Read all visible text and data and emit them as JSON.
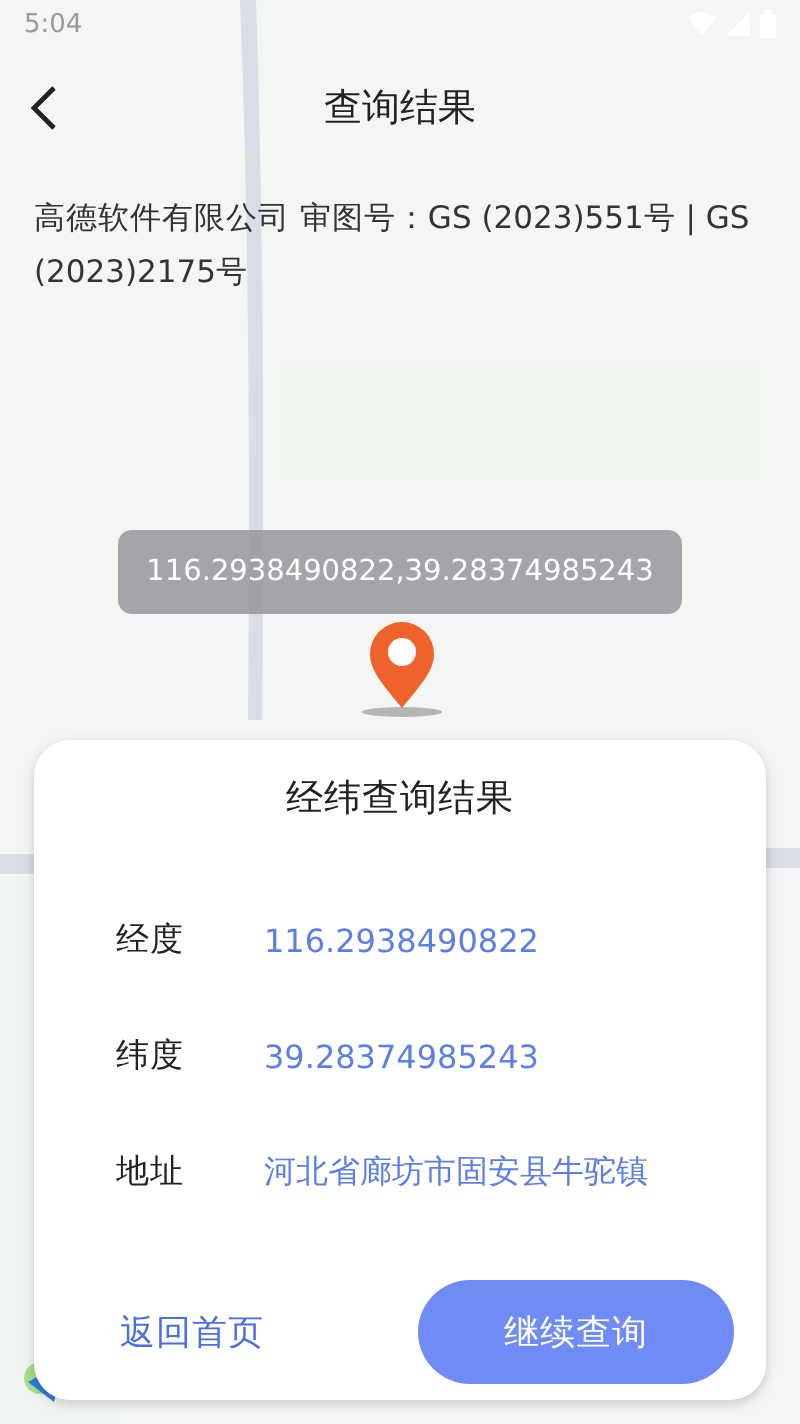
{
  "status_bar": {
    "time": "5:04"
  },
  "header": {
    "title": "查询结果"
  },
  "map": {
    "kind": "picture",
    "copyright": "高德软件有限公司 审图号：GS (2023)551号 | GS (2023)2175号",
    "marker_label": "116.2938490822,39.28374985243"
  },
  "result_card": {
    "title": "经纬查询结果",
    "rows": [
      {
        "label": "经度",
        "value": "116.2938490822"
      },
      {
        "label": "纬度",
        "value": "39.28374985243"
      },
      {
        "label": "地址",
        "value": "河北省廊坊市固安县牛驼镇"
      }
    ],
    "buttons": [
      {
        "label": "返回首页",
        "kind": "text"
      },
      {
        "label": "继续查询",
        "kind": "filled"
      }
    ]
  }
}
